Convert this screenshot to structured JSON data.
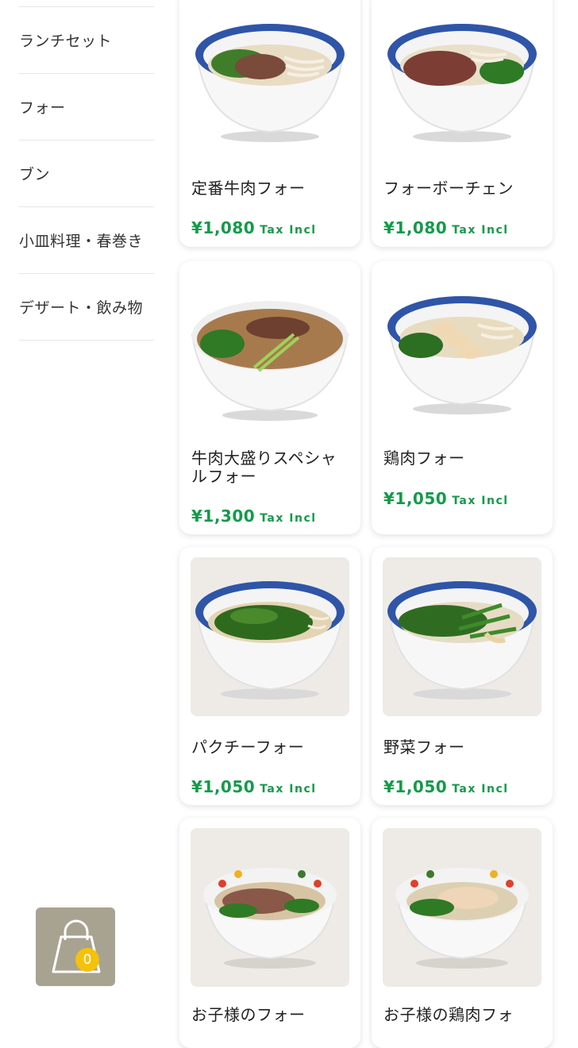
{
  "categories": [
    "ランチセット",
    "フォー",
    "ブン",
    "小皿料理・春巻き",
    "デザート・飲み物"
  ],
  "tax_label": "Tax Incl",
  "products": [
    {
      "name": "定番牛肉フォー",
      "price": "¥1,080"
    },
    {
      "name": "フォーボーチェン",
      "price": "¥1,080"
    },
    {
      "name": "牛肉大盛りスペシャルフォー",
      "price": "¥1,300"
    },
    {
      "name": "鶏肉フォー",
      "price": "¥1,050"
    },
    {
      "name": "パクチーフォー",
      "price": "¥1,050"
    },
    {
      "name": "野菜フォー",
      "price": "¥1,050"
    },
    {
      "name": "お子様のフォー",
      "price": ""
    },
    {
      "name": "お子様の鶏肉フォ",
      "price": ""
    }
  ],
  "cart": {
    "count": "0",
    "icon": "shopping-bag-icon"
  },
  "colors": {
    "price": "#149a4a",
    "cart_bg": "#a8a391",
    "badge": "#f5c20a"
  }
}
